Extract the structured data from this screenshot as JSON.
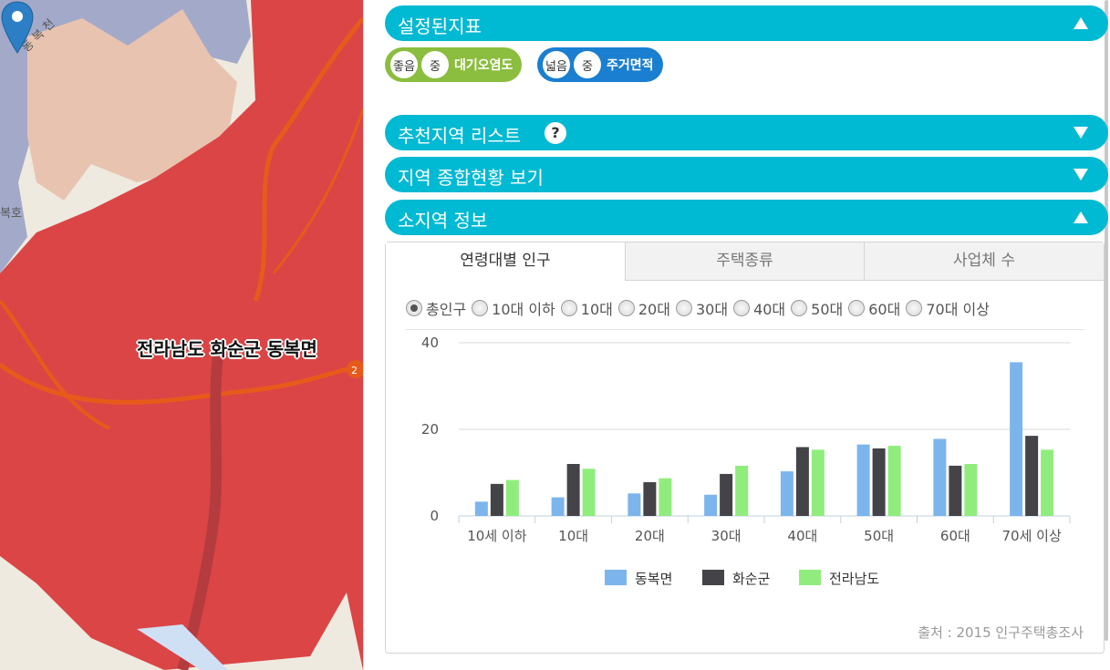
{
  "map": {
    "place_label": "전라남도 화순군 동복면",
    "lake_labels": [
      "동 복 천",
      "복호"
    ],
    "road_badge": "2"
  },
  "sections": {
    "indicators": {
      "title": "설정된지표",
      "state": "expanded"
    },
    "recommend": {
      "title": "추천지역 리스트",
      "help": "?",
      "state": "collapsed"
    },
    "overview": {
      "title": "지역 종합현황 보기",
      "state": "collapsed"
    },
    "subregion": {
      "title": "소지역 정보",
      "state": "expanded"
    }
  },
  "chips": [
    {
      "a": "좋음",
      "b": "중",
      "label": "대기오염도",
      "color": "#8bbd3e"
    },
    {
      "a": "넓음",
      "b": "중",
      "label": "주거면적",
      "color": "#1a7fd0"
    }
  ],
  "tabs": [
    "연령대별 인구",
    "주택종류",
    "사업체 수"
  ],
  "radio_options": [
    "총인구",
    "10대 이하",
    "10대",
    "20대",
    "30대",
    "40대",
    "50대",
    "60대",
    "70대 이상"
  ],
  "radio_selected": "총인구",
  "chart_data": {
    "type": "bar",
    "categories": [
      "10세 이하",
      "10대",
      "20대",
      "30대",
      "40대",
      "50대",
      "60대",
      "70세 이상"
    ],
    "series": [
      {
        "name": "동복면",
        "color": "#7cb5ec",
        "values": [
          3.3,
          4.3,
          5.2,
          4.9,
          10.3,
          16.5,
          17.8,
          35.5
        ]
      },
      {
        "name": "화순군",
        "color": "#434348",
        "values": [
          7.4,
          12.0,
          7.8,
          9.7,
          15.9,
          15.6,
          11.6,
          18.5
        ]
      },
      {
        "name": "전라남도",
        "color": "#90ed7d",
        "values": [
          8.3,
          10.9,
          8.7,
          11.6,
          15.3,
          16.2,
          12.0,
          15.3
        ]
      }
    ],
    "yticks": [
      0,
      20,
      40
    ],
    "ylim": [
      0,
      40
    ],
    "grid": true,
    "legend": "bottom"
  },
  "source": "출처 : 2015 인구주택총조사"
}
